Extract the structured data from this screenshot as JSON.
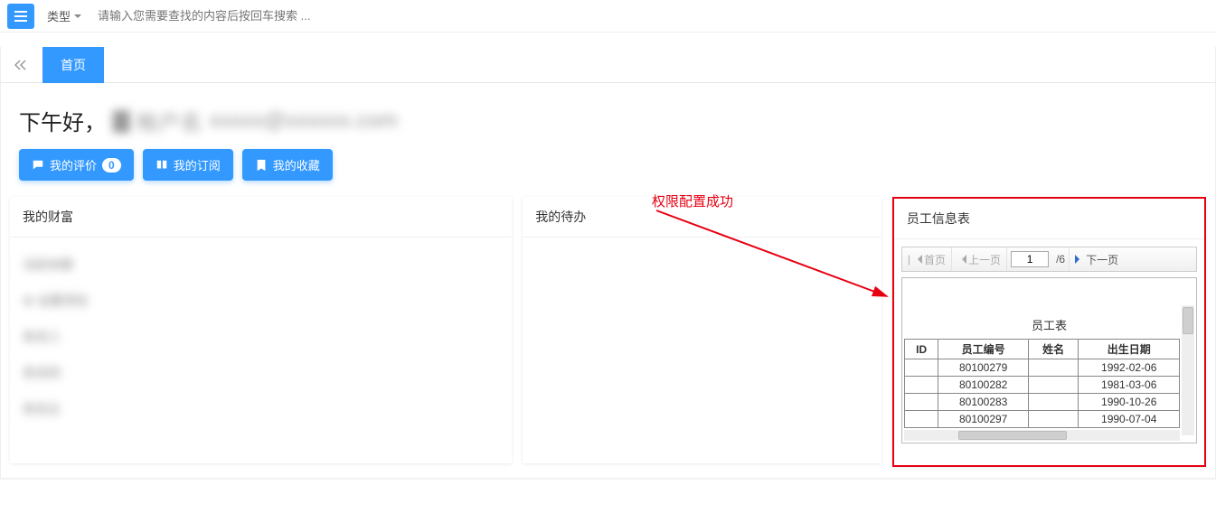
{
  "top": {
    "type_label": "类型",
    "search_placeholder": "请输入您需要查找的内容后按回车搜索 ..."
  },
  "tabs": {
    "home": "首页"
  },
  "greeting": {
    "prefix": "下午好，",
    "account_label": "帐户名",
    "masked": "xxxxx@xxxxxx.com"
  },
  "actions": {
    "review": "我的评价",
    "review_count": "0",
    "subscribe": "我的订阅",
    "favorite": "我的收藏"
  },
  "annotation": "权限配置成功",
  "panels": {
    "wealth": {
      "title": "我的财富"
    },
    "todo": {
      "title": "我的待办"
    },
    "emp": {
      "title": "员工信息表"
    }
  },
  "wealth_rows": [
    "当前余额",
    "⚙ 设置项目",
    "条目三",
    "条目四",
    "条目五"
  ],
  "pager": {
    "first": "首页",
    "prev": "上一页",
    "current": "1",
    "total": "/6",
    "next": "下一页"
  },
  "emp_table": {
    "title": "员工表",
    "headers": [
      "ID",
      "员工编号",
      "姓名",
      "出生日期"
    ],
    "rows": [
      {
        "id": "",
        "no": "80100279",
        "name": "",
        "dob": "1992-02-06"
      },
      {
        "id": "",
        "no": "80100282",
        "name": "",
        "dob": "1981-03-06"
      },
      {
        "id": "",
        "no": "80100283",
        "name": "",
        "dob": "1990-10-26"
      },
      {
        "id": "",
        "no": "80100297",
        "name": "",
        "dob": "1990-07-04"
      }
    ]
  }
}
